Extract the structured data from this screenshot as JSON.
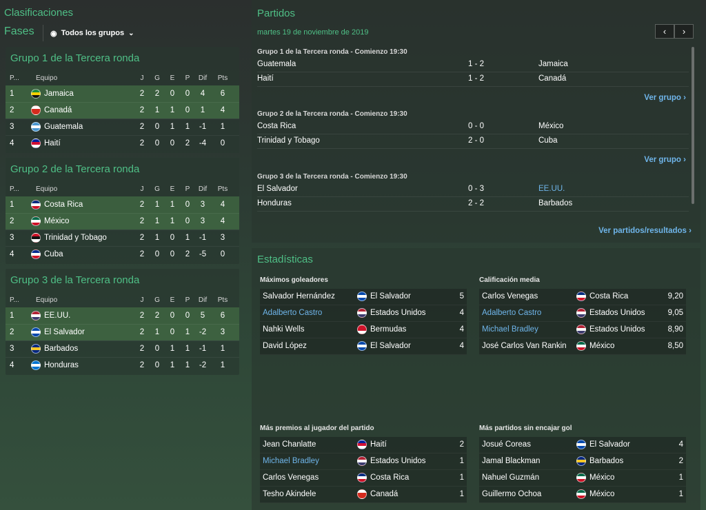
{
  "left": {
    "title": "Clasificaciones",
    "fases": "Fases",
    "filter_label": "Todos los grupos",
    "headers": {
      "pos": "P...",
      "team": "Equipo",
      "j": "J",
      "g": "G",
      "e": "E",
      "p": "P",
      "dif": "Dif",
      "pts": "Pts"
    },
    "groups": [
      {
        "title": "Grupo 1 de la Tercera ronda",
        "rows": [
          {
            "pos": "1",
            "team": "Jamaica",
            "j": "2",
            "g": "2",
            "e": "0",
            "p": "0",
            "dif": "4",
            "pts": "6",
            "flag": "jamaica"
          },
          {
            "pos": "2",
            "team": "Canadá",
            "j": "2",
            "g": "1",
            "e": "1",
            "p": "0",
            "dif": "1",
            "pts": "4",
            "flag": "canada"
          },
          {
            "pos": "3",
            "team": "Guatemala",
            "j": "2",
            "g": "0",
            "e": "1",
            "p": "1",
            "dif": "-1",
            "pts": "1",
            "flag": "guatemala"
          },
          {
            "pos": "4",
            "team": "Haití",
            "j": "2",
            "g": "0",
            "e": "0",
            "p": "2",
            "dif": "-4",
            "pts": "0",
            "flag": "haiti"
          }
        ]
      },
      {
        "title": "Grupo 2 de la Tercera ronda",
        "rows": [
          {
            "pos": "1",
            "team": "Costa Rica",
            "j": "2",
            "g": "1",
            "e": "1",
            "p": "0",
            "dif": "3",
            "pts": "4",
            "flag": "costarica"
          },
          {
            "pos": "2",
            "team": "México",
            "j": "2",
            "g": "1",
            "e": "1",
            "p": "0",
            "dif": "3",
            "pts": "4",
            "flag": "mexico"
          },
          {
            "pos": "3",
            "team": "Trinidad y Tobago",
            "j": "2",
            "g": "1",
            "e": "0",
            "p": "1",
            "dif": "-1",
            "pts": "3",
            "flag": "trinidad"
          },
          {
            "pos": "4",
            "team": "Cuba",
            "j": "2",
            "g": "0",
            "e": "0",
            "p": "2",
            "dif": "-5",
            "pts": "0",
            "flag": "cuba"
          }
        ]
      },
      {
        "title": "Grupo 3 de la Tercera ronda",
        "rows": [
          {
            "pos": "1",
            "team": "EE.UU.",
            "j": "2",
            "g": "2",
            "e": "0",
            "p": "0",
            "dif": "5",
            "pts": "6",
            "flag": "usa"
          },
          {
            "pos": "2",
            "team": "El Salvador",
            "j": "2",
            "g": "1",
            "e": "0",
            "p": "1",
            "dif": "-2",
            "pts": "3",
            "flag": "elsalvador"
          },
          {
            "pos": "3",
            "team": "Barbados",
            "j": "2",
            "g": "0",
            "e": "1",
            "p": "1",
            "dif": "-1",
            "pts": "1",
            "flag": "barbados"
          },
          {
            "pos": "4",
            "team": "Honduras",
            "j": "2",
            "g": "0",
            "e": "1",
            "p": "1",
            "dif": "-2",
            "pts": "1",
            "flag": "honduras"
          }
        ]
      }
    ]
  },
  "matches": {
    "title": "Partidos",
    "date": "martes 19 de noviembre de 2019",
    "ver_grupo": "Ver grupo",
    "ver_partidos": "Ver partidos/resultados",
    "groups": [
      {
        "title": "Grupo 1 de la Tercera ronda - Comienzo 19:30",
        "matches": [
          {
            "home": "Guatemala",
            "score": "1 - 2",
            "away": "Jamaica"
          },
          {
            "home": "Haití",
            "score": "1 - 2",
            "away": "Canadá"
          }
        ]
      },
      {
        "title": "Grupo 2 de la Tercera ronda - Comienzo 19:30",
        "matches": [
          {
            "home": "Costa Rica",
            "score": "0 - 0",
            "away": "México"
          },
          {
            "home": "Trinidad y Tobago",
            "score": "2 - 0",
            "away": "Cuba"
          }
        ]
      },
      {
        "title": "Grupo 3 de la Tercera ronda - Comienzo 19:30",
        "matches": [
          {
            "home": "El Salvador",
            "score": "0 - 3",
            "away": "EE.UU."
          },
          {
            "home": "Honduras",
            "score": "2 - 2",
            "away": "Barbados"
          }
        ]
      }
    ]
  },
  "stats": {
    "title": "Estadísticas",
    "blocks": [
      {
        "title": "Máximos goleadores",
        "rows": [
          {
            "name": "Salvador Hernández",
            "link": false,
            "team": "El Salvador",
            "flag": "elsalvador",
            "value": "5"
          },
          {
            "name": "Adalberto Castro",
            "link": true,
            "team": "Estados Unidos",
            "flag": "usa",
            "value": "4"
          },
          {
            "name": "Nahki Wells",
            "link": false,
            "team": "Bermudas",
            "flag": "bermuda",
            "value": "4"
          },
          {
            "name": "David López",
            "link": false,
            "team": "El Salvador",
            "flag": "elsalvador",
            "value": "4"
          }
        ]
      },
      {
        "title": "Calificación media",
        "rows": [
          {
            "name": "Carlos Venegas",
            "link": false,
            "team": "Costa Rica",
            "flag": "costarica",
            "value": "9,20"
          },
          {
            "name": "Adalberto Castro",
            "link": true,
            "team": "Estados Unidos",
            "flag": "usa",
            "value": "9,05"
          },
          {
            "name": "Michael Bradley",
            "link": true,
            "team": "Estados Unidos",
            "flag": "usa",
            "value": "8,90"
          },
          {
            "name": "José Carlos Van Rankin",
            "link": false,
            "team": "México",
            "flag": "mexico",
            "value": "8,50"
          }
        ]
      },
      {
        "title": "Más premios al jugador del partido",
        "rows": [
          {
            "name": "Jean Chanlatte",
            "link": false,
            "team": "Haití",
            "flag": "haiti",
            "value": "2"
          },
          {
            "name": "Michael Bradley",
            "link": true,
            "team": "Estados Unidos",
            "flag": "usa",
            "value": "1"
          },
          {
            "name": "Carlos Venegas",
            "link": false,
            "team": "Costa Rica",
            "flag": "costarica",
            "value": "1"
          },
          {
            "name": "Tesho Akindele",
            "link": false,
            "team": "Canadá",
            "flag": "canada",
            "value": "1"
          }
        ]
      },
      {
        "title": "Más partidos sin encajar gol",
        "rows": [
          {
            "name": "Josué Coreas",
            "link": false,
            "team": "El Salvador",
            "flag": "elsalvador",
            "value": "4"
          },
          {
            "name": "Jamal Blackman",
            "link": false,
            "team": "Barbados",
            "flag": "barbados",
            "value": "2"
          },
          {
            "name": "Nahuel Guzmán",
            "link": false,
            "team": "México",
            "flag": "mexico",
            "value": "1"
          },
          {
            "name": "Guillermo Ochoa",
            "link": false,
            "team": "México",
            "flag": "mexico",
            "value": "1"
          }
        ]
      }
    ]
  },
  "flag_colors": {
    "jamaica": [
      "#1f8a3c",
      "#f5d000",
      "#111111"
    ],
    "canada": [
      "#ffffff",
      "#d52b1e",
      "#d52b1e"
    ],
    "guatemala": [
      "#4997d0",
      "#ffffff",
      "#4997d0"
    ],
    "haiti": [
      "#00209f",
      "#d21034",
      "#ffffff"
    ],
    "costarica": [
      "#002b7f",
      "#ffffff",
      "#ce1126"
    ],
    "mexico": [
      "#006847",
      "#ffffff",
      "#ce1126"
    ],
    "trinidad": [
      "#ce1126",
      "#111111",
      "#ffffff"
    ],
    "cuba": [
      "#002a8f",
      "#ffffff",
      "#cf142b"
    ],
    "usa": [
      "#b22234",
      "#ffffff",
      "#3c3b6e"
    ],
    "elsalvador": [
      "#0047ab",
      "#ffffff",
      "#0047ab"
    ],
    "barbados": [
      "#00267f",
      "#ffc726",
      "#00267f"
    ],
    "honduras": [
      "#0073cf",
      "#ffffff",
      "#0073cf"
    ],
    "bermuda": [
      "#cf142b",
      "#cf142b",
      "#ffffff"
    ]
  }
}
